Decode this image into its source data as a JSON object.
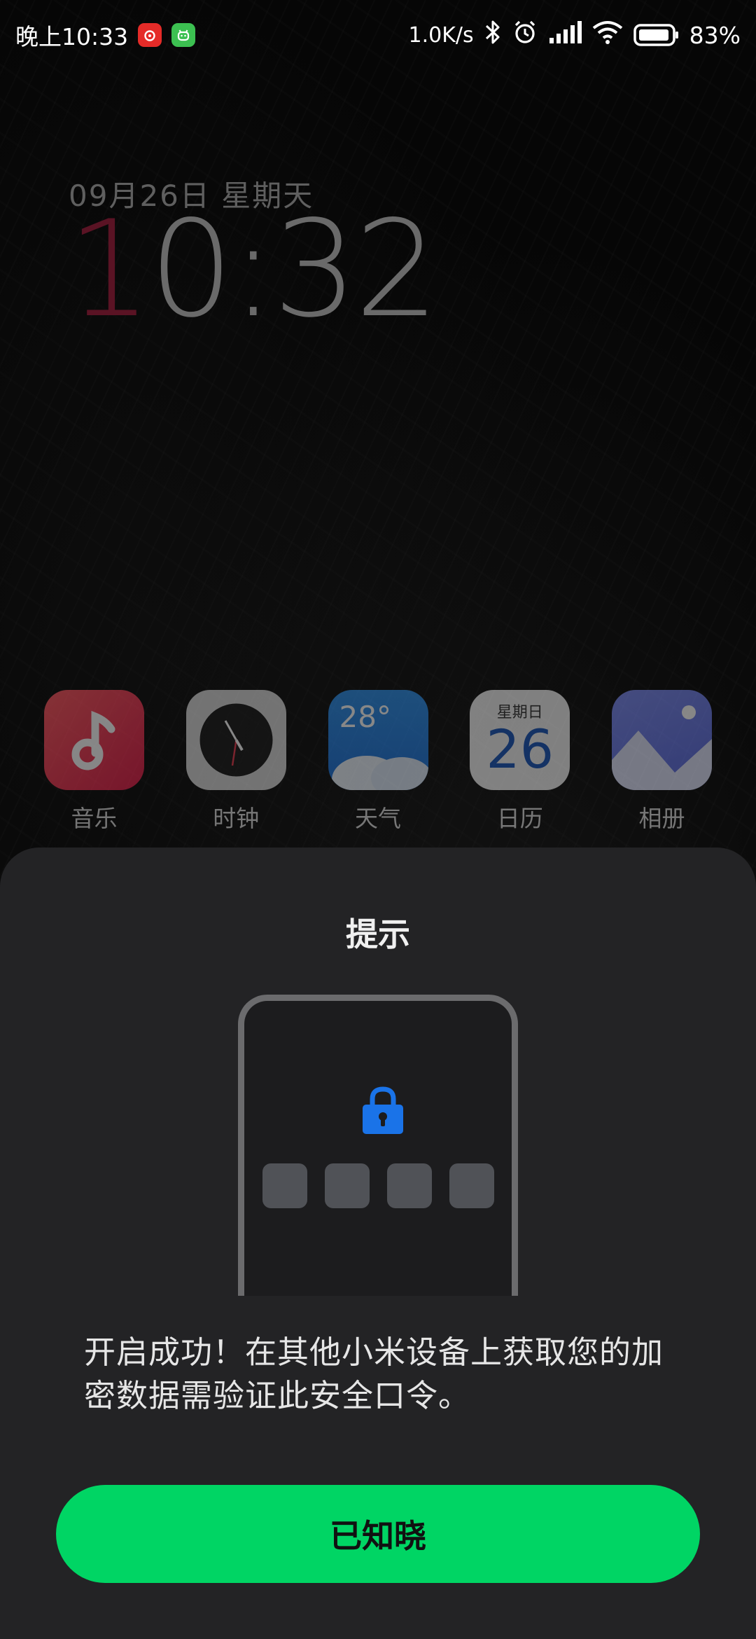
{
  "status_bar": {
    "time": "晚上10:33",
    "net_speed": "1.0K/s",
    "battery": "83%",
    "icons": [
      "netease-music-icon",
      "android-app-icon",
      "bluetooth-icon",
      "alarm-icon",
      "signal-icon",
      "wifi-icon",
      "battery-icon"
    ]
  },
  "lock_screen": {
    "date": "09月26日 星期天",
    "time_first": "1",
    "time_rest": "0:32"
  },
  "apps": [
    {
      "label": "音乐",
      "icon": "music-note-icon"
    },
    {
      "label": "时钟",
      "icon": "clock-icon"
    },
    {
      "label": "天气",
      "icon": "weather-icon",
      "temp": "28°"
    },
    {
      "label": "日历",
      "icon": "calendar-icon",
      "weekday": "星期日",
      "day": "26"
    },
    {
      "label": "相册",
      "icon": "gallery-icon"
    }
  ],
  "dialog": {
    "title": "提示",
    "message": "开启成功！在其他小米设备上获取您的加密数据需验证此安全口令。",
    "confirm_label": "已知晓",
    "accent_color": "#00d564",
    "lock_color": "#1a73e8"
  }
}
